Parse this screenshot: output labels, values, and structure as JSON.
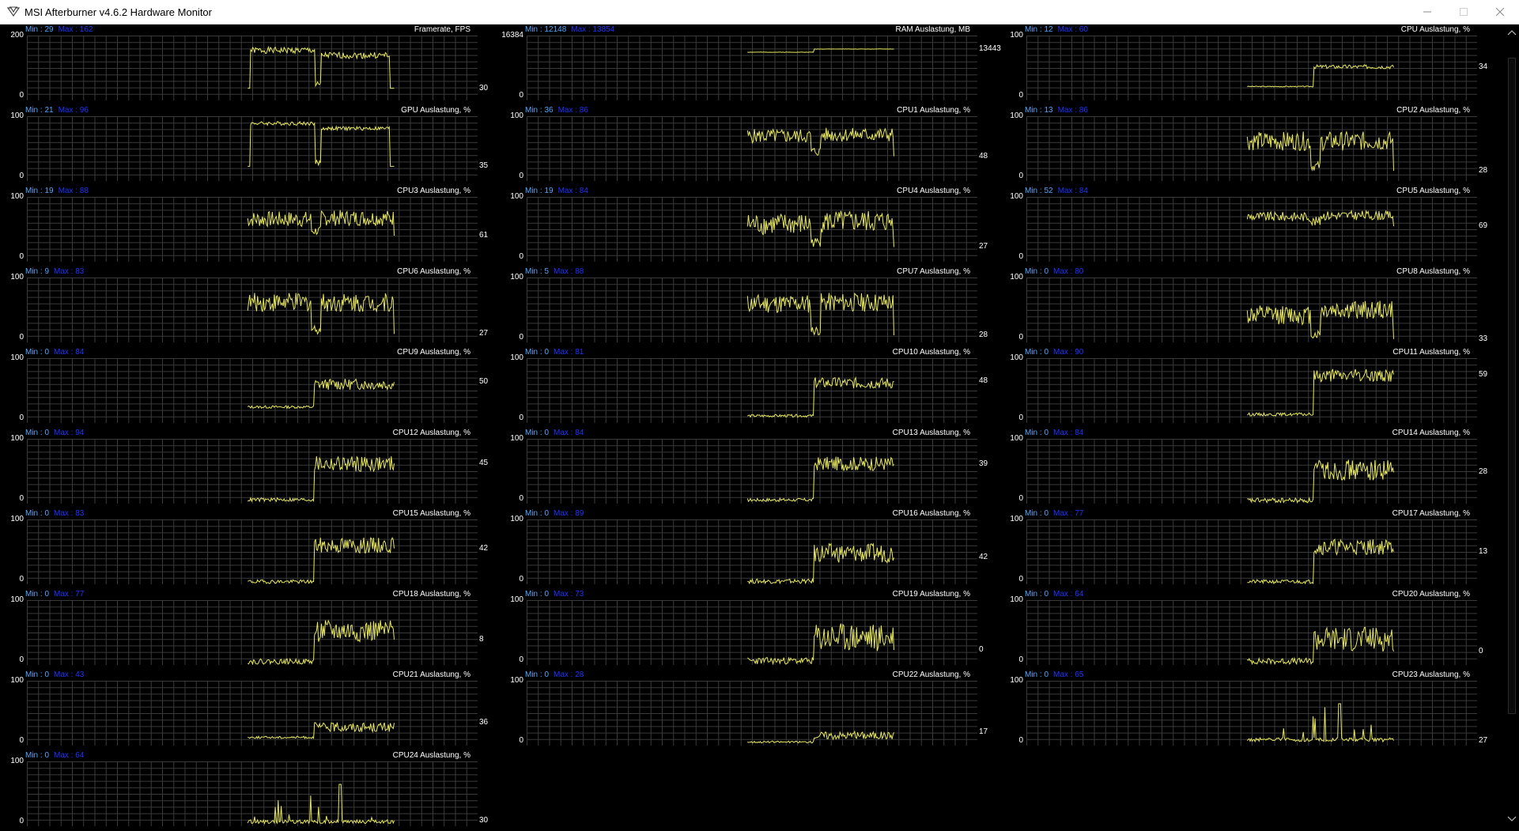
{
  "window": {
    "title": "MSI Afterburner v4.6.2 Hardware Monitor"
  },
  "colors": {
    "trace": "#e8e860",
    "grid": "#3a3a3a",
    "min_text": "#4da8ff",
    "max_text": "#1a35ff"
  },
  "icons": {
    "app": "afterburner-icon",
    "minimize": "minimize-icon",
    "maximize": "maximize-icon",
    "close": "close-icon"
  },
  "panels": [
    {
      "title": "Framerate, FPS",
      "min": "Min : 29",
      "max": "Max : 162",
      "y_top": "200",
      "y_bottom": "0",
      "current": "30",
      "start": 0.49,
      "end": 0.815,
      "style": "fps",
      "level": 0.78,
      "level2": 0.7,
      "low": 0.18,
      "noise": 0.05,
      "seed": 1
    },
    {
      "title": "RAM Auslastung, MB",
      "min": "Min : 12148",
      "max": "Max : 13854",
      "y_top": "16384",
      "y_bottom": "0",
      "current": "13443",
      "start": 0.49,
      "end": 0.815,
      "style": "flat",
      "level": 0.75,
      "level2": 0.8,
      "low": 0.75,
      "noise": 0.004,
      "seed": 2
    },
    {
      "title": "CPU Auslastung, %",
      "min": "Min : 12",
      "max": "Max : 60",
      "y_top": "100",
      "y_bottom": "0",
      "current": "34",
      "start": 0.49,
      "end": 0.815,
      "style": "step",
      "level": 0.2,
      "level2": 0.52,
      "low": 0.14,
      "noise": 0.025,
      "seed": 3
    },
    {
      "title": "GPU Auslastung, %",
      "min": "Min : 21",
      "max": "Max : 96",
      "y_top": "100",
      "y_bottom": "0",
      "current": "35",
      "start": 0.49,
      "end": 0.815,
      "style": "fps",
      "level": 0.9,
      "level2": 0.82,
      "low": 0.22,
      "noise": 0.03,
      "seed": 4
    },
    {
      "title": "CPU1 Auslastung, %",
      "min": "Min : 36",
      "max": "Max : 86",
      "y_top": "100",
      "y_bottom": "0",
      "current": "48",
      "start": 0.49,
      "end": 0.815,
      "style": "busy",
      "level": 0.7,
      "level2": 0.72,
      "low": 0.38,
      "noise": 0.09,
      "seed": 5
    },
    {
      "title": "CPU2 Auslastung, %",
      "min": "Min : 13",
      "max": "Max : 86",
      "y_top": "100",
      "y_bottom": "0",
      "current": "28",
      "start": 0.49,
      "end": 0.815,
      "style": "busy",
      "level": 0.62,
      "level2": 0.62,
      "low": 0.15,
      "noise": 0.12,
      "seed": 6
    },
    {
      "title": "CPU3 Auslastung, %",
      "min": "Min : 19",
      "max": "Max : 88",
      "y_top": "100",
      "y_bottom": "0",
      "current": "61",
      "start": 0.49,
      "end": 0.815,
      "style": "busy",
      "level": 0.66,
      "level2": 0.68,
      "low": 0.4,
      "noise": 0.1,
      "seed": 7
    },
    {
      "title": "CPU4 Auslastung, %",
      "min": "Min : 19",
      "max": "Max : 84",
      "y_top": "100",
      "y_bottom": "0",
      "current": "27",
      "start": 0.49,
      "end": 0.815,
      "style": "busy",
      "level": 0.58,
      "level2": 0.62,
      "low": 0.22,
      "noise": 0.14,
      "seed": 8
    },
    {
      "title": "CPU5 Auslastung, %",
      "min": "Min : 52",
      "max": "Max : 84",
      "y_top": "100",
      "y_bottom": "0",
      "current": "69",
      "start": 0.49,
      "end": 0.815,
      "style": "busy",
      "level": 0.7,
      "level2": 0.72,
      "low": 0.55,
      "noise": 0.06,
      "seed": 9
    },
    {
      "title": "CPU6 Auslastung, %",
      "min": "Min : 9",
      "max": "Max : 83",
      "y_top": "100",
      "y_bottom": "0",
      "current": "27",
      "start": 0.49,
      "end": 0.815,
      "style": "busy",
      "level": 0.62,
      "level2": 0.62,
      "low": 0.12,
      "noise": 0.12,
      "seed": 10
    },
    {
      "title": "CPU7 Auslastung, %",
      "min": "Min : 5",
      "max": "Max : 88",
      "y_top": "100",
      "y_bottom": "0",
      "current": "28",
      "start": 0.49,
      "end": 0.815,
      "style": "busy",
      "level": 0.6,
      "level2": 0.62,
      "low": 0.1,
      "noise": 0.12,
      "seed": 11
    },
    {
      "title": "CPU8 Auslastung, %",
      "min": "Min : 0",
      "max": "Max : 80",
      "y_top": "100",
      "y_bottom": "0",
      "current": "33",
      "start": 0.49,
      "end": 0.815,
      "style": "busy",
      "level": 0.42,
      "level2": 0.5,
      "low": 0.04,
      "noise": 0.12,
      "seed": 12
    },
    {
      "title": "CPU9 Auslastung, %",
      "min": "Min : 0",
      "max": "Max : 84",
      "y_top": "100",
      "y_bottom": "0",
      "current": "50",
      "start": 0.49,
      "end": 0.815,
      "style": "step",
      "level": 0.22,
      "level2": 0.6,
      "low": 0.05,
      "noise": 0.07,
      "seed": 13
    },
    {
      "title": "CPU10 Auslastung, %",
      "min": "Min : 0",
      "max": "Max : 81",
      "y_top": "100",
      "y_bottom": "0",
      "current": "48",
      "start": 0.49,
      "end": 0.815,
      "style": "step",
      "level": 0.08,
      "level2": 0.62,
      "low": 0.04,
      "noise": 0.07,
      "seed": 14
    },
    {
      "title": "CPU11 Auslastung, %",
      "min": "Min : 0",
      "max": "Max : 90",
      "y_top": "100",
      "y_bottom": "0",
      "current": "59",
      "start": 0.49,
      "end": 0.815,
      "style": "step",
      "level": 0.1,
      "level2": 0.74,
      "low": 0.04,
      "noise": 0.08,
      "seed": 15
    },
    {
      "title": "CPU12 Auslastung, %",
      "min": "Min : 0",
      "max": "Max : 94",
      "y_top": "100",
      "y_bottom": "0",
      "current": "45",
      "start": 0.49,
      "end": 0.815,
      "style": "step",
      "level": 0.02,
      "level2": 0.62,
      "low": 0.0,
      "noise": 0.1,
      "seed": 16
    },
    {
      "title": "CPU13 Auslastung, %",
      "min": "Min : 0",
      "max": "Max : 84",
      "y_top": "100",
      "y_bottom": "0",
      "current": "39",
      "start": 0.49,
      "end": 0.815,
      "style": "step",
      "level": 0.02,
      "level2": 0.62,
      "low": 0.0,
      "noise": 0.09,
      "seed": 17
    },
    {
      "title": "CPU14 Auslastung, %",
      "min": "Min : 0",
      "max": "Max : 84",
      "y_top": "100",
      "y_bottom": "0",
      "current": "28",
      "start": 0.49,
      "end": 0.815,
      "style": "step",
      "level": 0.0,
      "level2": 0.52,
      "low": 0.0,
      "noise": 0.13,
      "seed": 18
    },
    {
      "title": "CPU15 Auslastung, %",
      "min": "Min : 0",
      "max": "Max : 83",
      "y_top": "100",
      "y_bottom": "0",
      "current": "42",
      "start": 0.49,
      "end": 0.815,
      "style": "step",
      "level": 0.0,
      "level2": 0.6,
      "low": 0.0,
      "noise": 0.1,
      "seed": 19
    },
    {
      "title": "CPU16 Auslastung, %",
      "min": "Min : 0",
      "max": "Max : 89",
      "y_top": "100",
      "y_bottom": "0",
      "current": "42",
      "start": 0.49,
      "end": 0.815,
      "style": "step",
      "level": 0.0,
      "level2": 0.48,
      "low": 0.0,
      "noise": 0.12,
      "seed": 20
    },
    {
      "title": "CPU17 Auslastung, %",
      "min": "Min : 0",
      "max": "Max : 77",
      "y_top": "100",
      "y_bottom": "0",
      "current": "13",
      "start": 0.49,
      "end": 0.815,
      "style": "step",
      "level": 0.0,
      "level2": 0.58,
      "low": 0.0,
      "noise": 0.1,
      "seed": 21
    },
    {
      "title": "CPU18 Auslastung, %",
      "min": "Min : 0",
      "max": "Max : 77",
      "y_top": "100",
      "y_bottom": "0",
      "current": "8",
      "start": 0.49,
      "end": 0.815,
      "style": "step",
      "level": 0.0,
      "level2": 0.52,
      "low": 0.0,
      "noise": 0.14,
      "seed": 22
    },
    {
      "title": "CPU19 Auslastung, %",
      "min": "Min : 0",
      "max": "Max : 73",
      "y_top": "100",
      "y_bottom": "0",
      "current": "0",
      "start": 0.49,
      "end": 0.815,
      "style": "step",
      "level": 0.0,
      "level2": 0.42,
      "low": 0.0,
      "noise": 0.18,
      "seed": 23
    },
    {
      "title": "CPU20 Auslastung, %",
      "min": "Min : 0",
      "max": "Max : 64",
      "y_top": "100",
      "y_bottom": "0",
      "current": "0",
      "start": 0.49,
      "end": 0.815,
      "style": "step",
      "level": 0.0,
      "level2": 0.4,
      "low": 0.0,
      "noise": 0.16,
      "seed": 24
    },
    {
      "title": "CPU21 Auslastung, %",
      "min": "Min : 0",
      "max": "Max : 43",
      "y_top": "100",
      "y_bottom": "0",
      "current": "36",
      "start": 0.49,
      "end": 0.815,
      "style": "step",
      "level": 0.1,
      "level2": 0.28,
      "low": 0.05,
      "noise": 0.06,
      "seed": 25
    },
    {
      "title": "CPU22 Auslastung, %",
      "min": "Min : 0",
      "max": "Max : 28",
      "y_top": "100",
      "y_bottom": "0",
      "current": "17",
      "start": 0.49,
      "end": 0.815,
      "style": "step",
      "level": 0.03,
      "level2": 0.15,
      "low": 0.0,
      "noise": 0.05,
      "seed": 26
    },
    {
      "title": "CPU23 Auslastung, %",
      "min": "Min : 0",
      "max": "Max : 65",
      "y_top": "100",
      "y_bottom": "0",
      "current": "27",
      "start": 0.49,
      "end": 0.815,
      "style": "spiky",
      "level": 0.05,
      "level2": 0.08,
      "low": 0.0,
      "noise": 0.06,
      "seed": 27
    },
    {
      "title": "CPU24 Auslastung, %",
      "min": "Min : 0",
      "max": "Max : 64",
      "y_top": "100",
      "y_bottom": "0",
      "current": "30",
      "start": 0.49,
      "end": 0.815,
      "style": "spiky",
      "level": 0.03,
      "level2": 0.06,
      "low": 0.0,
      "noise": 0.06,
      "seed": 28
    }
  ]
}
